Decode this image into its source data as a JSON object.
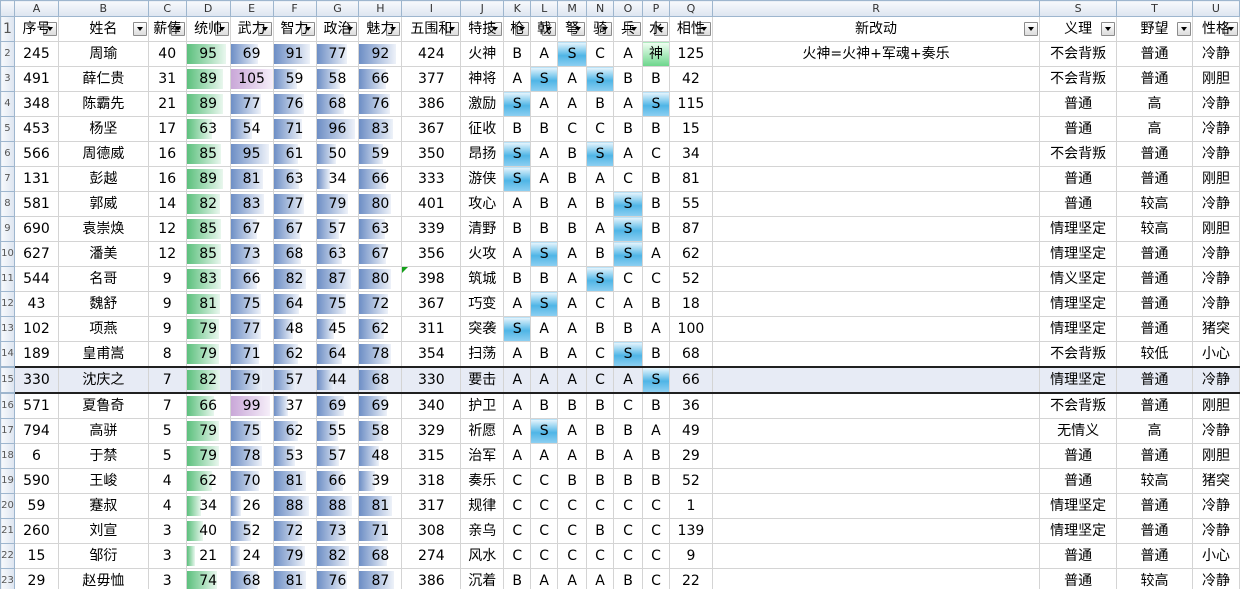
{
  "col_letters": [
    "A",
    "B",
    "C",
    "D",
    "E",
    "F",
    "G",
    "H",
    "I",
    "J",
    "K",
    "L",
    "M",
    "N",
    "O",
    "P",
    "Q",
    "R",
    "S",
    "T",
    "U"
  ],
  "headers": [
    "序号",
    "姓名",
    "薪俸",
    "统帅",
    "武力",
    "智力",
    "政治",
    "魅力",
    "五围和",
    "特技",
    "枪",
    "戟",
    "弩",
    "骑",
    "兵",
    "水",
    "相性",
    "新改动",
    "义理",
    "野望",
    "性格"
  ],
  "filter_icon": "filter-dropdown-icon",
  "colors": {
    "accent_S": "#4fb5e6",
    "accent_shen": "#6ad58a",
    "bar_tongshuai": "#5cc07d",
    "bar_stats": "#6d8ec5",
    "bar_high": "#c9a7d8",
    "comment_marker": "#15a01a",
    "header_bg": "#dde5f0"
  },
  "rows": [
    {
      "rownum": "2",
      "id": "245",
      "name": "周瑜",
      "salary": "40",
      "ts": "95",
      "wl": "69",
      "zl": "91",
      "zz": "77",
      "ml": "92",
      "sum": "424",
      "skill": "火神",
      "qiang": "B",
      "ji": "A",
      "nu": "S",
      "qi": "C",
      "bing": "A",
      "shui": "神",
      "xiang": "125",
      "note": "火神=火神+军魂+奏乐",
      "yili": "不会背叛",
      "yewang": "普通",
      "xingge": "冷静"
    },
    {
      "rownum": "3",
      "id": "491",
      "name": "薛仁贵",
      "salary": "31",
      "ts": "89",
      "wl": "105",
      "zl": "59",
      "zz": "58",
      "ml": "66",
      "sum": "377",
      "skill": "神将",
      "qiang": "A",
      "ji": "S",
      "nu": "A",
      "qi": "S",
      "bing": "B",
      "shui": "B",
      "xiang": "42",
      "note": "",
      "yili": "不会背叛",
      "yewang": "普通",
      "xingge": "刚胆"
    },
    {
      "rownum": "4",
      "id": "348",
      "name": "陈霸先",
      "salary": "21",
      "ts": "89",
      "wl": "77",
      "zl": "76",
      "zz": "68",
      "ml": "76",
      "sum": "386",
      "skill": "激励",
      "qiang": "S",
      "ji": "A",
      "nu": "A",
      "qi": "B",
      "bing": "A",
      "shui": "S",
      "xiang": "115",
      "note": "",
      "yili": "普通",
      "yewang": "高",
      "xingge": "冷静"
    },
    {
      "rownum": "5",
      "id": "453",
      "name": "杨坚",
      "salary": "17",
      "ts": "63",
      "wl": "54",
      "zl": "71",
      "zz": "96",
      "ml": "83",
      "sum": "367",
      "skill": "征收",
      "qiang": "B",
      "ji": "B",
      "nu": "C",
      "qi": "C",
      "bing": "B",
      "shui": "B",
      "xiang": "15",
      "note": "",
      "yili": "普通",
      "yewang": "高",
      "xingge": "冷静"
    },
    {
      "rownum": "6",
      "id": "566",
      "name": "周德威",
      "salary": "16",
      "ts": "85",
      "wl": "95",
      "zl": "61",
      "zz": "50",
      "ml": "59",
      "sum": "350",
      "skill": "昂扬",
      "qiang": "S",
      "ji": "A",
      "nu": "B",
      "qi": "S",
      "bing": "A",
      "shui": "C",
      "xiang": "34",
      "note": "",
      "yili": "不会背叛",
      "yewang": "普通",
      "xingge": "冷静"
    },
    {
      "rownum": "7",
      "id": "131",
      "name": "彭越",
      "salary": "16",
      "ts": "89",
      "wl": "81",
      "zl": "63",
      "zz": "34",
      "ml": "66",
      "sum": "333",
      "skill": "游侠",
      "qiang": "S",
      "ji": "A",
      "nu": "B",
      "qi": "A",
      "bing": "C",
      "shui": "B",
      "xiang": "81",
      "note": "",
      "yili": "普通",
      "yewang": "普通",
      "xingge": "刚胆"
    },
    {
      "rownum": "8",
      "id": "581",
      "name": "郭威",
      "salary": "14",
      "ts": "82",
      "wl": "83",
      "zl": "77",
      "zz": "79",
      "ml": "80",
      "sum": "401",
      "skill": "攻心",
      "qiang": "A",
      "ji": "B",
      "nu": "A",
      "qi": "B",
      "bing": "S",
      "shui": "B",
      "xiang": "55",
      "note": "",
      "yili": "普通",
      "yewang": "较高",
      "xingge": "冷静"
    },
    {
      "rownum": "9",
      "id": "690",
      "name": "袁崇焕",
      "salary": "12",
      "ts": "85",
      "wl": "67",
      "zl": "67",
      "zz": "57",
      "ml": "63",
      "sum": "339",
      "skill": "清野",
      "qiang": "B",
      "ji": "B",
      "nu": "B",
      "qi": "A",
      "bing": "S",
      "shui": "B",
      "xiang": "87",
      "note": "",
      "yili": "情理坚定",
      "yewang": "较高",
      "xingge": "刚胆"
    },
    {
      "rownum": "10",
      "id": "627",
      "name": "潘美",
      "salary": "12",
      "ts": "85",
      "wl": "73",
      "zl": "68",
      "zz": "63",
      "ml": "67",
      "sum": "356",
      "skill": "火攻",
      "qiang": "A",
      "ji": "S",
      "nu": "A",
      "qi": "B",
      "bing": "S",
      "shui": "A",
      "xiang": "62",
      "note": "",
      "yili": "情理坚定",
      "yewang": "普通",
      "xingge": "冷静"
    },
    {
      "rownum": "11",
      "id": "544",
      "name": "名哥",
      "salary": "9",
      "ts": "83",
      "wl": "66",
      "zl": "82",
      "zz": "87",
      "ml": "80",
      "sum": "398",
      "skill": "筑城",
      "qiang": "B",
      "ji": "B",
      "nu": "A",
      "qi": "S",
      "bing": "C",
      "shui": "C",
      "xiang": "52",
      "note": "",
      "yili": "情义坚定",
      "yewang": "普通",
      "xingge": "冷静",
      "comment": true
    },
    {
      "rownum": "12",
      "id": "43",
      "name": "魏舒",
      "salary": "9",
      "ts": "81",
      "wl": "75",
      "zl": "64",
      "zz": "75",
      "ml": "72",
      "sum": "367",
      "skill": "巧变",
      "qiang": "A",
      "ji": "S",
      "nu": "A",
      "qi": "C",
      "bing": "A",
      "shui": "B",
      "xiang": "18",
      "note": "",
      "yili": "情理坚定",
      "yewang": "普通",
      "xingge": "冷静"
    },
    {
      "rownum": "13",
      "id": "102",
      "name": "项燕",
      "salary": "9",
      "ts": "79",
      "wl": "77",
      "zl": "48",
      "zz": "45",
      "ml": "62",
      "sum": "311",
      "skill": "突袭",
      "qiang": "S",
      "ji": "A",
      "nu": "A",
      "qi": "B",
      "bing": "B",
      "shui": "A",
      "xiang": "100",
      "note": "",
      "yili": "情理坚定",
      "yewang": "普通",
      "xingge": "猪突"
    },
    {
      "rownum": "14",
      "id": "189",
      "name": "皇甫嵩",
      "salary": "8",
      "ts": "79",
      "wl": "71",
      "zl": "62",
      "zz": "64",
      "ml": "78",
      "sum": "354",
      "skill": "扫荡",
      "qiang": "A",
      "ji": "B",
      "nu": "A",
      "qi": "C",
      "bing": "S",
      "shui": "B",
      "xiang": "68",
      "note": "",
      "yili": "不会背叛",
      "yewang": "较低",
      "xingge": "小心"
    },
    {
      "rownum": "15",
      "id": "330",
      "name": "沈庆之",
      "salary": "7",
      "ts": "82",
      "wl": "79",
      "zl": "57",
      "zz": "44",
      "ml": "68",
      "sum": "330",
      "skill": "要击",
      "qiang": "A",
      "ji": "A",
      "nu": "A",
      "qi": "C",
      "bing": "A",
      "shui": "S",
      "xiang": "66",
      "note": "",
      "yili": "情理坚定",
      "yewang": "普通",
      "xingge": "冷静",
      "selected": true
    },
    {
      "rownum": "16",
      "id": "571",
      "name": "夏鲁奇",
      "salary": "7",
      "ts": "66",
      "wl": "99",
      "zl": "37",
      "zz": "69",
      "ml": "69",
      "sum": "340",
      "skill": "护卫",
      "qiang": "A",
      "ji": "B",
      "nu": "B",
      "qi": "B",
      "bing": "C",
      "shui": "B",
      "xiang": "36",
      "note": "",
      "yili": "不会背叛",
      "yewang": "普通",
      "xingge": "刚胆"
    },
    {
      "rownum": "17",
      "id": "794",
      "name": "高骈",
      "salary": "5",
      "ts": "79",
      "wl": "75",
      "zl": "62",
      "zz": "55",
      "ml": "58",
      "sum": "329",
      "skill": "祈愿",
      "qiang": "A",
      "ji": "S",
      "nu": "A",
      "qi": "B",
      "bing": "B",
      "shui": "A",
      "xiang": "49",
      "note": "",
      "yili": "无情义",
      "yewang": "高",
      "xingge": "冷静"
    },
    {
      "rownum": "18",
      "id": "6",
      "name": "于禁",
      "salary": "5",
      "ts": "79",
      "wl": "78",
      "zl": "53",
      "zz": "57",
      "ml": "48",
      "sum": "315",
      "skill": "治军",
      "qiang": "A",
      "ji": "A",
      "nu": "A",
      "qi": "B",
      "bing": "A",
      "shui": "B",
      "xiang": "29",
      "note": "",
      "yili": "普通",
      "yewang": "普通",
      "xingge": "刚胆"
    },
    {
      "rownum": "19",
      "id": "590",
      "name": "王峻",
      "salary": "4",
      "ts": "62",
      "wl": "70",
      "zl": "81",
      "zz": "66",
      "ml": "39",
      "sum": "318",
      "skill": "奏乐",
      "qiang": "C",
      "ji": "C",
      "nu": "B",
      "qi": "B",
      "bing": "B",
      "shui": "B",
      "xiang": "52",
      "note": "",
      "yili": "普通",
      "yewang": "较高",
      "xingge": "猪突"
    },
    {
      "rownum": "20",
      "id": "59",
      "name": "蹇叔",
      "salary": "4",
      "ts": "34",
      "wl": "26",
      "zl": "88",
      "zz": "88",
      "ml": "81",
      "sum": "317",
      "skill": "规律",
      "qiang": "C",
      "ji": "C",
      "nu": "C",
      "qi": "C",
      "bing": "C",
      "shui": "C",
      "xiang": "1",
      "note": "",
      "yili": "情理坚定",
      "yewang": "普通",
      "xingge": "冷静"
    },
    {
      "rownum": "21",
      "id": "260",
      "name": "刘宣",
      "salary": "3",
      "ts": "40",
      "wl": "52",
      "zl": "72",
      "zz": "73",
      "ml": "71",
      "sum": "308",
      "skill": "亲乌",
      "qiang": "C",
      "ji": "C",
      "nu": "C",
      "qi": "B",
      "bing": "C",
      "shui": "C",
      "xiang": "139",
      "note": "",
      "yili": "情理坚定",
      "yewang": "普通",
      "xingge": "冷静"
    },
    {
      "rownum": "22",
      "id": "15",
      "name": "邹衍",
      "salary": "3",
      "ts": "21",
      "wl": "24",
      "zl": "79",
      "zz": "82",
      "ml": "68",
      "sum": "274",
      "skill": "风水",
      "qiang": "C",
      "ji": "C",
      "nu": "C",
      "qi": "C",
      "bing": "C",
      "shui": "C",
      "xiang": "9",
      "note": "",
      "yili": "普通",
      "yewang": "普通",
      "xingge": "小心"
    },
    {
      "rownum": "23",
      "id": "29",
      "name": "赵毋恤",
      "salary": "3",
      "ts": "74",
      "wl": "68",
      "zl": "81",
      "zz": "76",
      "ml": "87",
      "sum": "386",
      "skill": "沉着",
      "qiang": "B",
      "ji": "A",
      "nu": "A",
      "qi": "A",
      "bing": "B",
      "shui": "C",
      "xiang": "22",
      "note": "",
      "yili": "普通",
      "yewang": "较高",
      "xingge": "冷静"
    }
  ]
}
